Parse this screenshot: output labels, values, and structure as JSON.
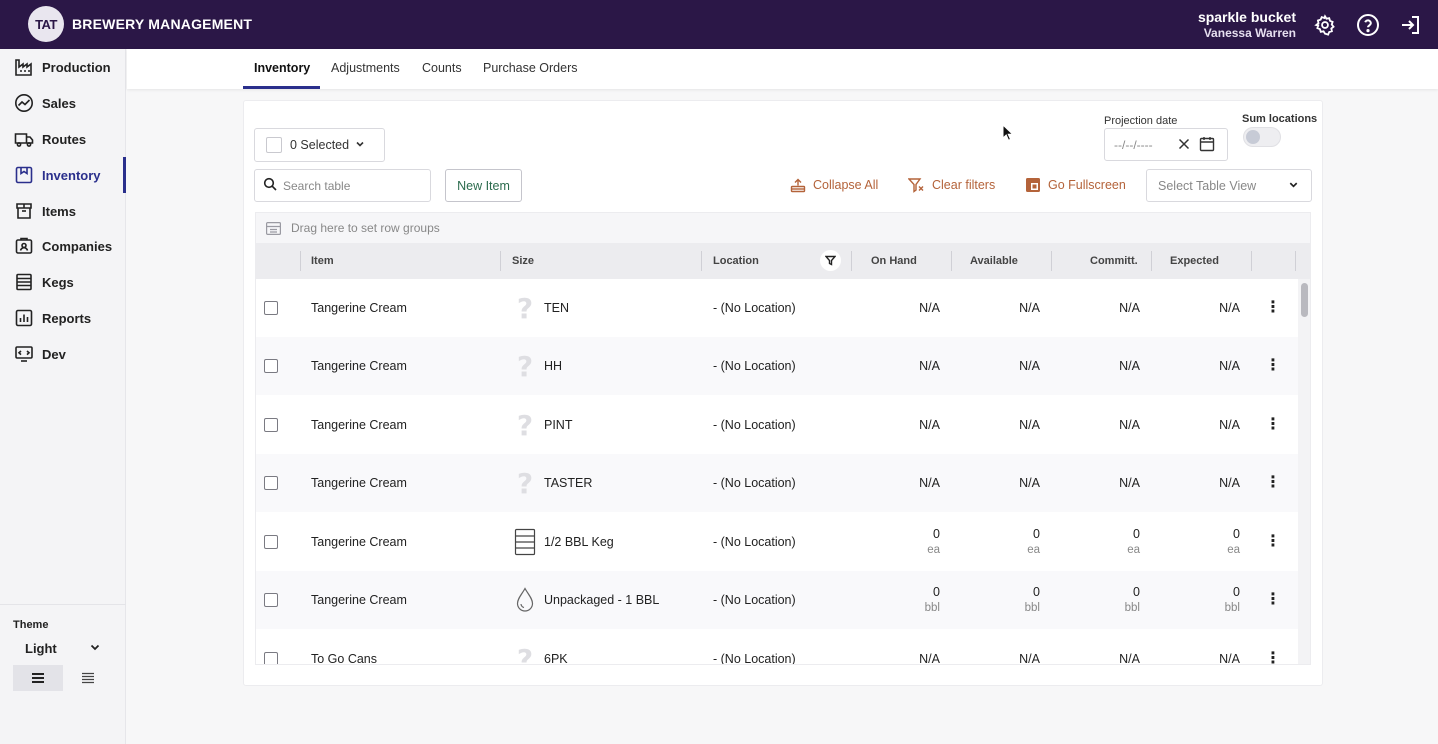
{
  "app": {
    "logo_text": "TAT",
    "title": "BREWERY MANAGEMENT"
  },
  "user": {
    "company": "sparkle bucket",
    "name": "Vanessa Warren"
  },
  "top_icons": [
    "gear-icon",
    "help-icon",
    "logout-icon"
  ],
  "sidebar": {
    "items": [
      {
        "label": "Production",
        "icon": "factory-icon"
      },
      {
        "label": "Sales",
        "icon": "trend-icon"
      },
      {
        "label": "Routes",
        "icon": "truck-icon"
      },
      {
        "label": "Inventory",
        "icon": "inventory-icon",
        "active": true
      },
      {
        "label": "Items",
        "icon": "boxes-icon"
      },
      {
        "label": "Companies",
        "icon": "contact-icon"
      },
      {
        "label": "Kegs",
        "icon": "keg-icon"
      },
      {
        "label": "Reports",
        "icon": "report-icon"
      },
      {
        "label": "Dev",
        "icon": "dev-icon"
      }
    ],
    "theme_label": "Theme",
    "theme_value": "Light"
  },
  "tabs": [
    {
      "label": "Inventory",
      "active": true
    },
    {
      "label": "Adjustments"
    },
    {
      "label": "Counts"
    },
    {
      "label": "Purchase Orders"
    }
  ],
  "toolbar": {
    "selected_label": "0 Selected",
    "projection_label": "Projection date",
    "projection_value": "--/--/----",
    "sum_locations_label": "Sum locations",
    "sum_locations_on": false,
    "search_placeholder": "Search table",
    "new_item_label": "New Item",
    "collapse_all_label": "Collapse All",
    "clear_filters_label": "Clear filters",
    "fullscreen_label": "Go Fullscreen",
    "table_view_placeholder": "Select Table View"
  },
  "grid": {
    "group_bar_text": "Drag here to set row groups",
    "columns": [
      "Item",
      "Size",
      "Location",
      "On Hand",
      "Available",
      "Committ.",
      "Expected"
    ],
    "rows": [
      {
        "item": "Tangerine Cream",
        "size_icon": "question-icon",
        "size": "TEN",
        "location": "- (No Location)",
        "on_hand": "N/A",
        "available": "N/A",
        "committed": "N/A",
        "expected": "N/A",
        "unit": ""
      },
      {
        "item": "Tangerine Cream",
        "size_icon": "question-icon",
        "size": "HH",
        "location": "- (No Location)",
        "on_hand": "N/A",
        "available": "N/A",
        "committed": "N/A",
        "expected": "N/A",
        "unit": ""
      },
      {
        "item": "Tangerine Cream",
        "size_icon": "question-icon",
        "size": "PINT",
        "location": "- (No Location)",
        "on_hand": "N/A",
        "available": "N/A",
        "committed": "N/A",
        "expected": "N/A",
        "unit": ""
      },
      {
        "item": "Tangerine Cream",
        "size_icon": "question-icon",
        "size": "TASTER",
        "location": "- (No Location)",
        "on_hand": "N/A",
        "available": "N/A",
        "committed": "N/A",
        "expected": "N/A",
        "unit": ""
      },
      {
        "item": "Tangerine Cream",
        "size_icon": "keg-icon",
        "size": "1/2 BBL Keg",
        "location": "- (No Location)",
        "on_hand": "0",
        "available": "0",
        "committed": "0",
        "expected": "0",
        "unit": "ea"
      },
      {
        "item": "Tangerine Cream",
        "size_icon": "drop-icon",
        "size": "Unpackaged - 1 BBL",
        "location": "- (No Location)",
        "on_hand": "0",
        "available": "0",
        "committed": "0",
        "expected": "0",
        "unit": "bbl"
      },
      {
        "item": "To Go Cans",
        "size_icon": "question-icon",
        "size": "6PK",
        "location": "- (No Location)",
        "on_hand": "N/A",
        "available": "N/A",
        "committed": "N/A",
        "expected": "N/A",
        "unit": ""
      }
    ]
  },
  "colors": {
    "topbar": "#2b1747",
    "accent": "#2a2f8c",
    "tool_action": "#b4633a",
    "new_item_text": "#2b6b4d"
  }
}
